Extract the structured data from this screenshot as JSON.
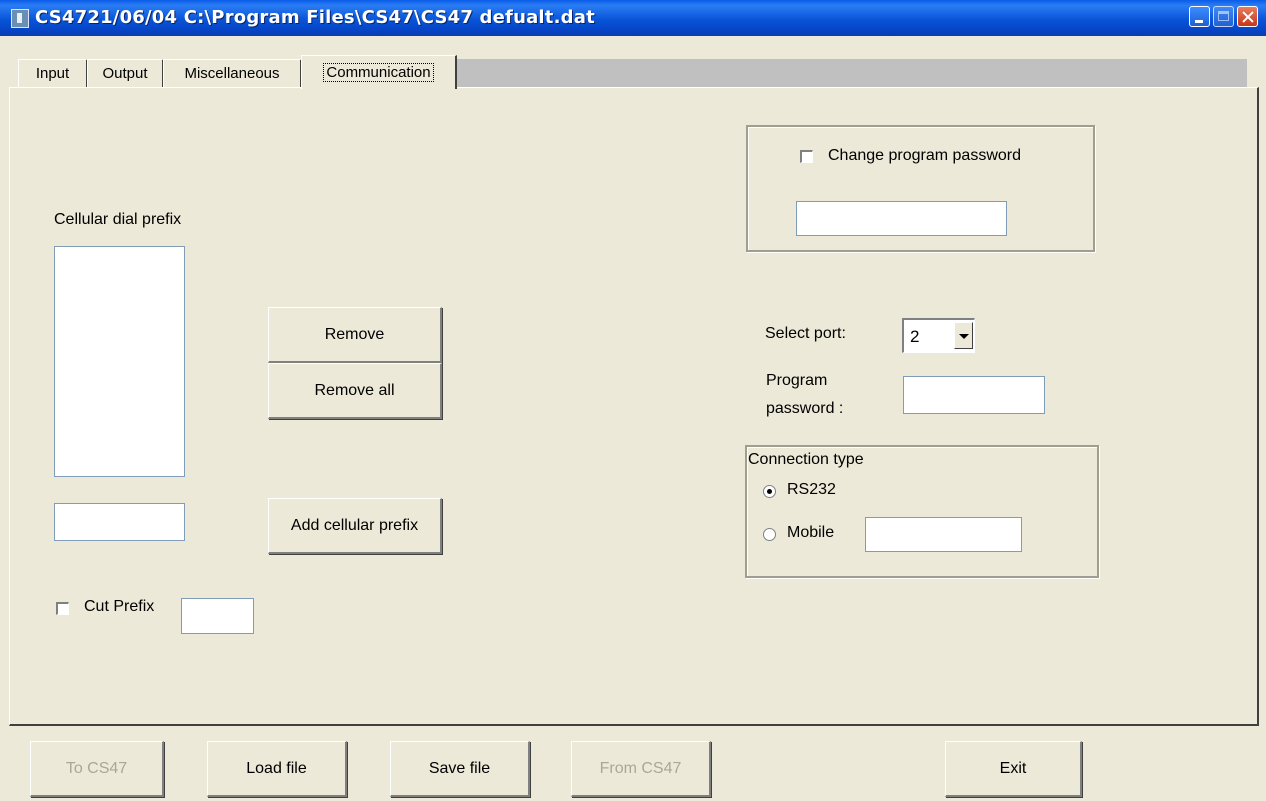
{
  "window": {
    "title": "CS4721/06/04  C:\\Program Files\\CS47\\CS47 defualt.dat"
  },
  "tabs": [
    {
      "label": "Input"
    },
    {
      "label": "Output"
    },
    {
      "label": "Miscellaneous"
    },
    {
      "label": "Communication",
      "selected": true
    }
  ],
  "prefix": {
    "label": "Cellular dial prefix",
    "items": [],
    "input_value": "",
    "remove_label": "Remove",
    "remove_all_label": "Remove all",
    "add_label": "Add cellular prefix",
    "cut_prefix_label": "Cut Prefix",
    "cut_prefix_checked": false,
    "cut_prefix_value": ""
  },
  "password_group": {
    "change_label": "Change program password",
    "change_checked": false,
    "value": ""
  },
  "port": {
    "label": "Select port:",
    "selected": "2"
  },
  "program_password": {
    "label_line1": "Program",
    "label_line2": "password :",
    "value": ""
  },
  "connection": {
    "title": "Connection type",
    "options": [
      {
        "label": "RS232",
        "selected": true
      },
      {
        "label": "Mobile",
        "selected": false
      }
    ],
    "mobile_value": ""
  },
  "footer": {
    "to_cs47": "To CS47",
    "load_file": "Load file",
    "save_file": "Save file",
    "from_cs47": "From CS47",
    "exit": "Exit"
  },
  "colors": {
    "titlebar": "#0a5ce8",
    "face": "#ece9d8",
    "disabled_text": "#a8a89a"
  }
}
